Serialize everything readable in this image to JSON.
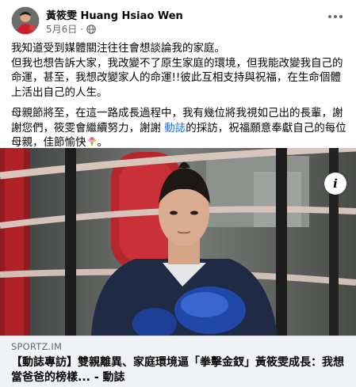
{
  "post": {
    "author": "黃筱雯 Huang Hsiao Wen",
    "date": "5月6日",
    "date_separator": "·",
    "paragraph1": "我知道受到媒體關注往往會想談論我的家庭。\n但我也想告訴大家，我改變不了原生家庭的環境，但我能改變我自己的命運，甚至，我想改變家人的命運!!彼此互相支持與祝福，在生命個體上活出自己的人生。",
    "paragraph2_before_tag": "母親節將至，在這一路成長過程中，我有幾位將我視如己出的長輩，謝謝您們，筱雯會繼續努力，謝謝 ",
    "tag": "動誌",
    "paragraph2_after_tag": "的採訪，祝福願意奉獻自己的每位母親，佳節愉快",
    "paragraph2_end": "。"
  },
  "link_preview": {
    "domain": "SPORTZ.IM",
    "title": "【動誌專訪】雙親離異、家庭環境逼「拳擊金釵」黃筱雯成長：我想當爸爸的榜樣... - 動誌",
    "info_label": "i"
  },
  "icons": {
    "globe": "globe-icon",
    "more": "more-options-icon",
    "bouquet": "bouquet-emoji-icon",
    "info": "info-icon"
  },
  "colors": {
    "link": "#216fdb",
    "secondary_text": "#65676b",
    "footer_bg": "#f0f2f5"
  }
}
